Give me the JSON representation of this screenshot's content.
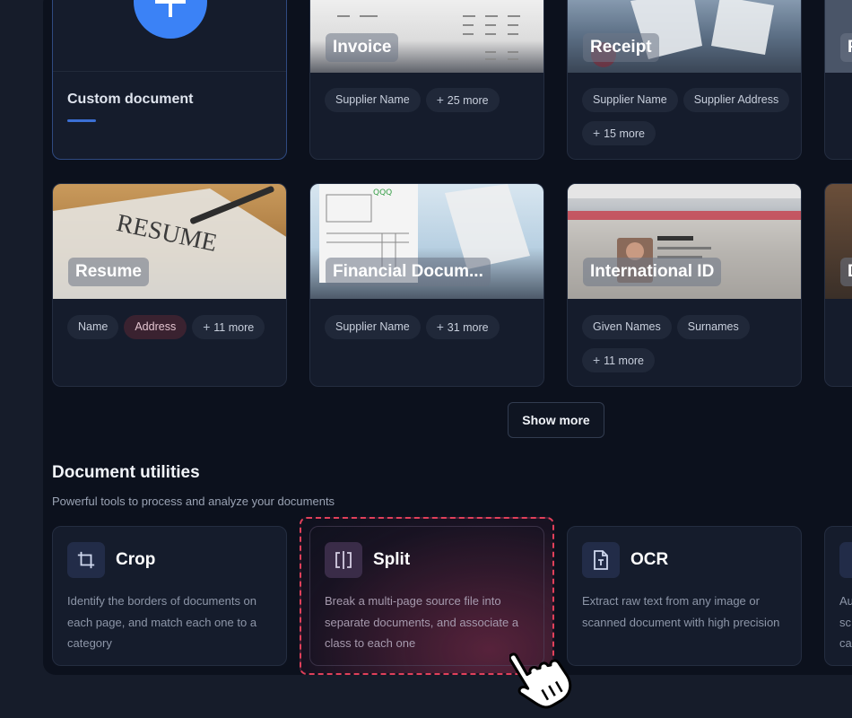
{
  "custom_card": {
    "label": "Custom document"
  },
  "templates": [
    {
      "title": "Invoice",
      "chips": [
        "Supplier Name",
        "25 more"
      ]
    },
    {
      "title": "Receipt",
      "chips": [
        "Supplier Name",
        "Supplier Address",
        "15 more"
      ]
    },
    {
      "title": "Resume",
      "chips": [
        "Name",
        "Address",
        "11 more"
      ]
    },
    {
      "title": "Financial Docum...",
      "chips": [
        "Supplier Name",
        "31 more"
      ]
    },
    {
      "title": "International ID",
      "chips": [
        "Given Names",
        "Surnames",
        "11 more"
      ]
    }
  ],
  "show_more_label": "Show more",
  "utilities": {
    "title": "Document utilities",
    "subtitle": "Powerful tools to process and analyze your documents",
    "items": [
      {
        "title": "Crop",
        "icon": "crop-icon",
        "desc": "Identify the borders of documents on each page, and match each one to a category"
      },
      {
        "title": "Split",
        "icon": "split-icon",
        "desc": "Break a multi-page source file into separate documents, and associate a class to each one"
      },
      {
        "title": "OCR",
        "icon": "ocr-document-icon",
        "desc": "Extract raw text from any image or scanned document with high precision"
      }
    ]
  },
  "partial_text": {
    "receipt_next_initial": "P",
    "id_next_initial": "D",
    "util4_lines": [
      "Au",
      "sc",
      "ca"
    ]
  },
  "colors": {
    "accent_blue": "#3b82f6",
    "selection_red": "#e0405a",
    "panel": "#0c111d"
  }
}
